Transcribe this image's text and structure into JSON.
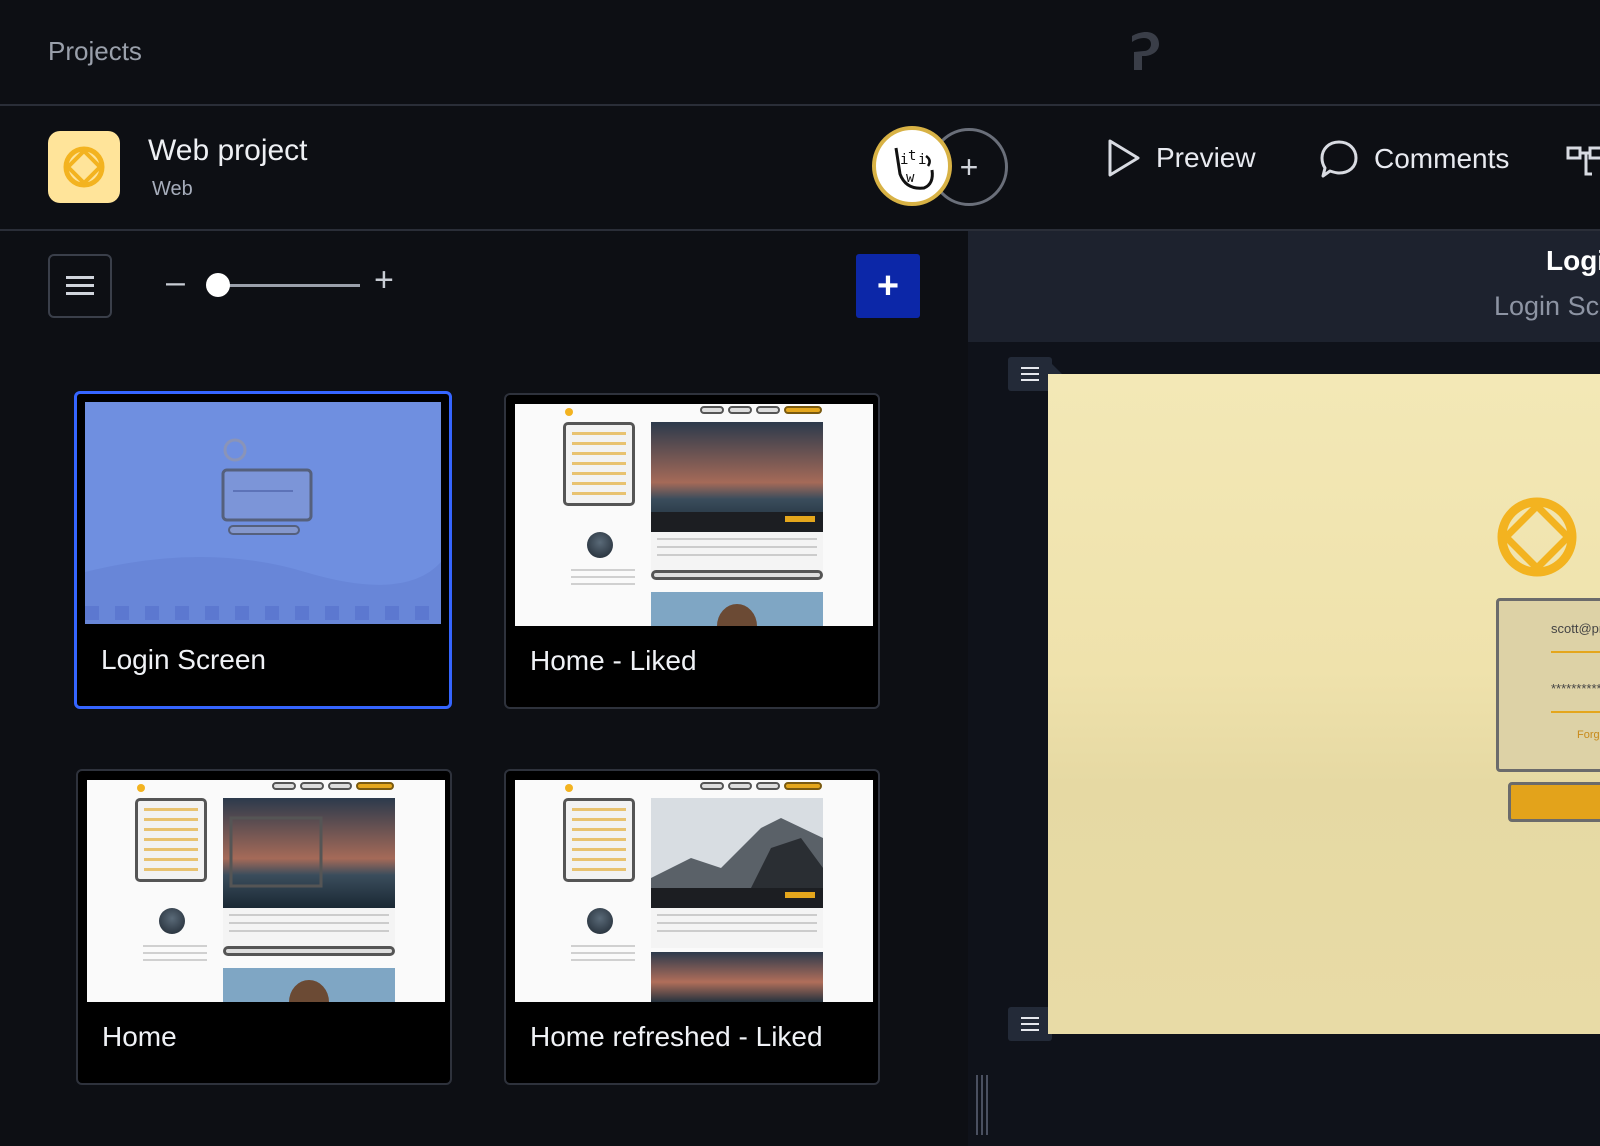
{
  "topbar": {
    "breadcrumb": "Projects",
    "brand_icon": "brand-p-icon"
  },
  "project": {
    "title": "Web project",
    "type": "Web",
    "icon": "capture-logo-icon",
    "icon_bg": "#ffe49a"
  },
  "header_actions": {
    "preview_label": "Preview",
    "comments_label": "Comments",
    "add_collaborator": "+"
  },
  "toolbar": {
    "zoom_minus": "–",
    "zoom_plus": "+",
    "add_screen": "+",
    "zoom_level": 0.05
  },
  "screens": [
    {
      "label": "Login Screen",
      "selected": true
    },
    {
      "label": "Home - Liked",
      "selected": false
    },
    {
      "label": "Home",
      "selected": false
    },
    {
      "label": "Home refreshed - Liked",
      "selected": false
    }
  ],
  "detail": {
    "title": "Logi",
    "subtitle": "Login Sc",
    "login_email": "scott@pro",
    "login_password": "**********",
    "login_forgot": "Forgo"
  },
  "colors": {
    "accent_blue": "#3565ff",
    "add_button": "#0c27a8",
    "brand_gold": "#f3b320"
  }
}
